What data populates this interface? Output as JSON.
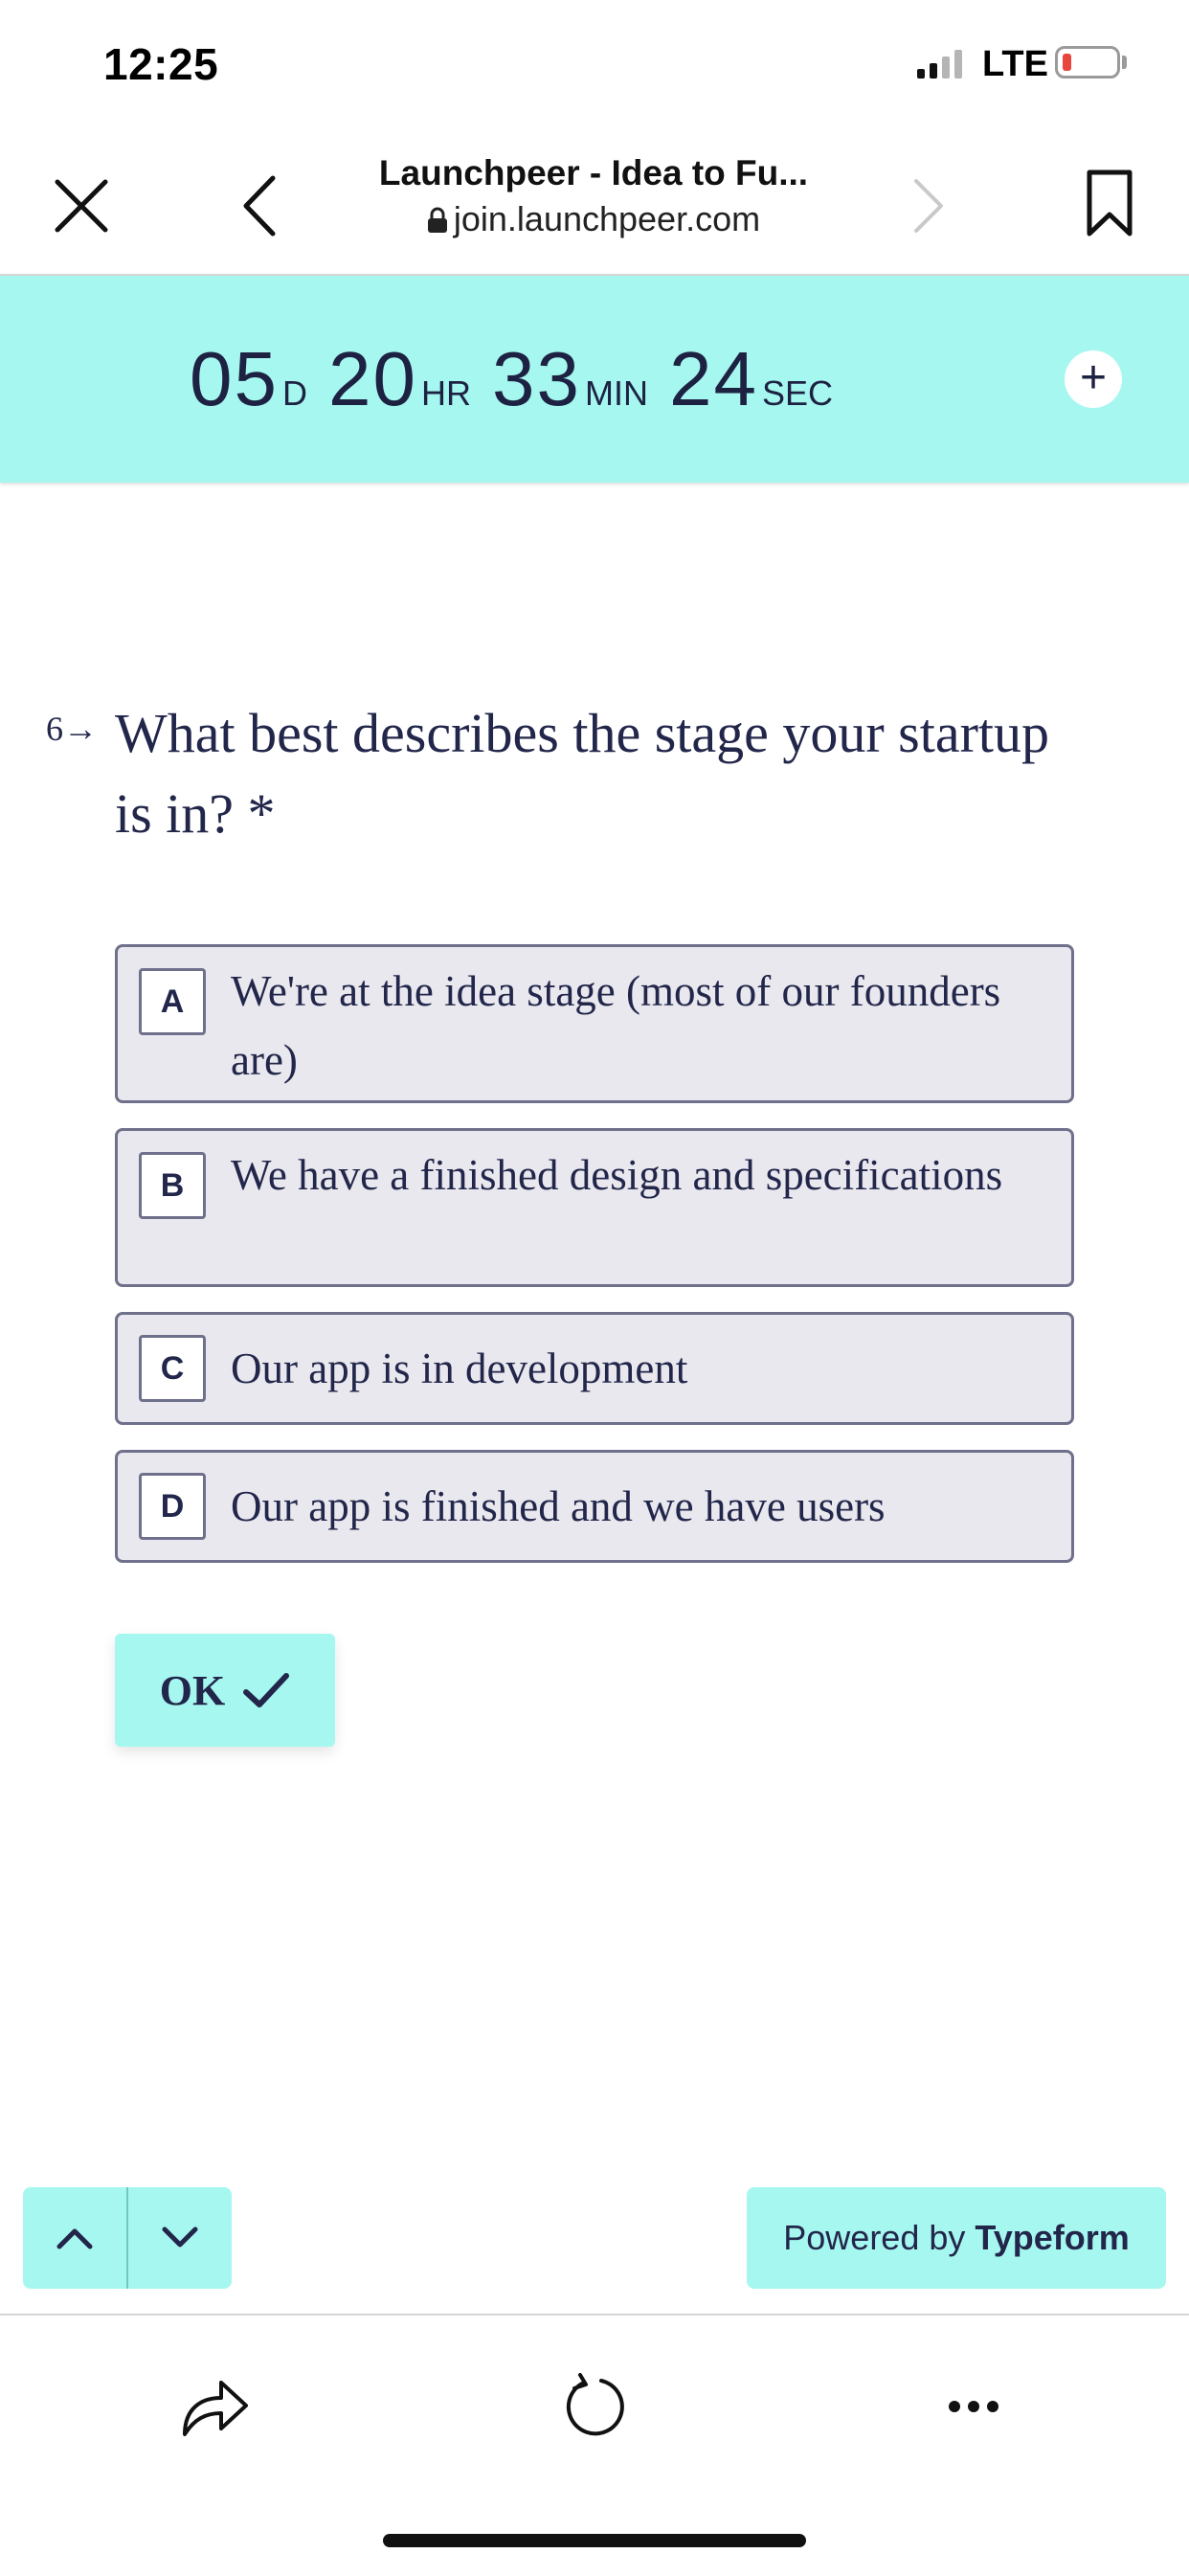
{
  "status_bar": {
    "time": "12:25",
    "network": "LTE"
  },
  "browser": {
    "title": "Launchpeer - Idea to Fu...",
    "url": "join.launchpeer.com",
    "icons": [
      "close-icon",
      "back-icon",
      "lock-icon",
      "forward-icon",
      "bookmark-icon"
    ]
  },
  "countdown": {
    "days": "05",
    "days_unit": "D",
    "hours": "20",
    "hours_unit": "HR",
    "minutes": "33",
    "minutes_unit": "MIN",
    "seconds": "24",
    "seconds_unit": "SEC",
    "add_icon": "plus-icon"
  },
  "question": {
    "number": "6",
    "text": "What best describes the stage your startup is in? *",
    "options": [
      {
        "key": "A",
        "label": "We're at the idea stage (most of our founders are)"
      },
      {
        "key": "B",
        "label": "We have a finished design and specifications"
      },
      {
        "key": "C",
        "label": "Our app is in development"
      },
      {
        "key": "D",
        "label": "Our app is finished and we have users"
      }
    ],
    "ok_label": "OK"
  },
  "footer": {
    "powered_prefix": "Powered by",
    "powered_brand": "Typeform"
  },
  "colors": {
    "accent": "#a6f7f0",
    "text": "#22264a",
    "option_bg": "#e9e8ee",
    "option_border": "#6f718c"
  }
}
